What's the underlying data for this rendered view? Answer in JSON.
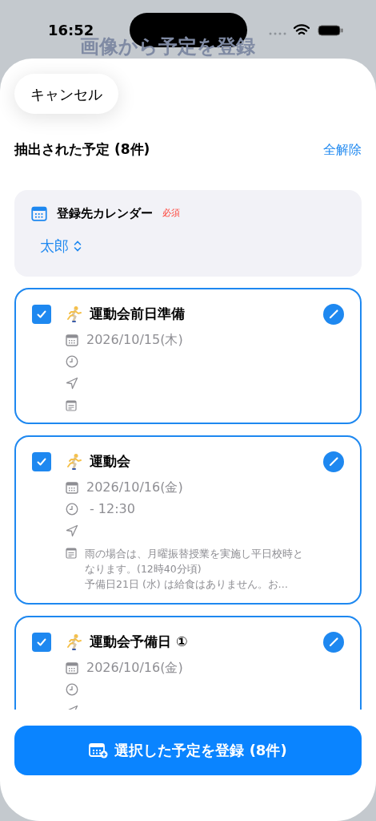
{
  "status_bar": {
    "time": "16:52"
  },
  "background_title": "画像から予定を登録",
  "cancel_button": "キャンセル",
  "header": {
    "title": "抽出された予定 (8件)",
    "action": "全解除"
  },
  "calendar_picker": {
    "label": "登録先カレンダー",
    "required": "必須",
    "value": "太郎"
  },
  "events": [
    {
      "checked": true,
      "title": "運動会前日準備",
      "date": "2026/10/15(木)"
    },
    {
      "checked": true,
      "title": "運動会",
      "date": "2026/10/16(金)",
      "time": "- 12:30",
      "notes": "雨の場合は、月曜振替授業を実施し平日校時となります。(12時40分頃)\n予備日21日 (水) は給食はありません。お…"
    },
    {
      "checked": true,
      "title": "運動会予備日 ①",
      "date": "2026/10/16(金)"
    }
  ],
  "submit_button": "選択した予定を登録 (8件)"
}
